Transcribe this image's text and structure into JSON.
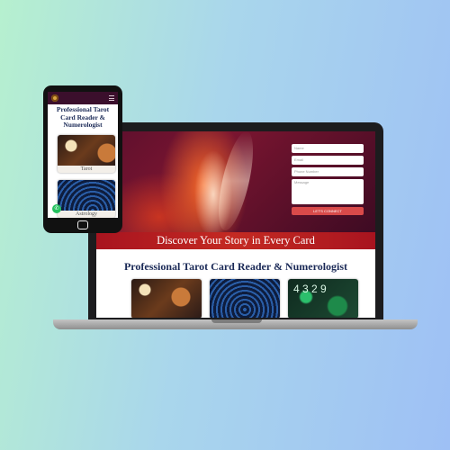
{
  "laptop": {
    "form": {
      "name_placeholder": "Name",
      "email_placeholder": "Email",
      "phone_placeholder": "Phone Number",
      "message_placeholder": "Message",
      "submit_label": "LET'S CONNECT"
    },
    "banner_text": "Discover Your Story in Every Card",
    "heading": "Professional Tarot Card Reader & Numerologist",
    "thumbnails": [
      {
        "name": "tarot"
      },
      {
        "name": "astrology"
      },
      {
        "name": "numerology",
        "digits": "4  3  2  9"
      }
    ]
  },
  "phone": {
    "heading": "Professional Tarot Card Reader & Numerologist",
    "cards": [
      {
        "caption": "Tarot"
      },
      {
        "caption": "Astrology"
      }
    ],
    "whatsapp_icon": "whatsapp-icon"
  }
}
